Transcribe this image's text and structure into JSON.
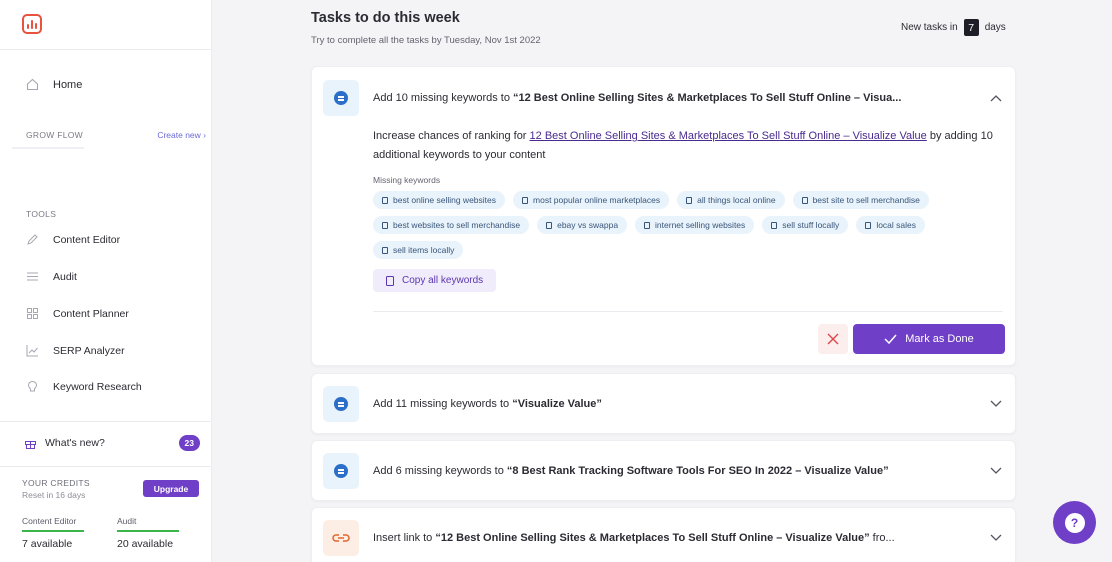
{
  "sidebar": {
    "home_label": "Home",
    "grow_flow_label": "GROW FLOW",
    "create_new_label": "Create new ›",
    "tools_label": "TOOLS",
    "tools": [
      {
        "label": "Content Editor",
        "icon": "pencil-icon"
      },
      {
        "label": "Audit",
        "icon": "lines-icon"
      },
      {
        "label": "Content Planner",
        "icon": "grid-icon"
      },
      {
        "label": "SERP Analyzer",
        "icon": "chart-line-icon"
      },
      {
        "label": "Keyword Research",
        "icon": "lightbulb-icon"
      }
    ],
    "whats_new_label": "What's new?",
    "whats_new_count": "23",
    "credits_title": "YOUR CREDITS",
    "credits_reset": "Reset in 16 days",
    "upgrade_label": "Upgrade",
    "credit_items": [
      {
        "label": "Content Editor",
        "value": "7 available"
      },
      {
        "label": "Audit",
        "value": "20 available"
      }
    ]
  },
  "header": {
    "title": "Tasks to do this week",
    "subtitle": "Try to complete all the tasks by Tuesday, Nov 1st 2022",
    "new_tasks_label": "New tasks in",
    "new_tasks_days": "7",
    "days_label": "days"
  },
  "tasks": [
    {
      "title_prefix": "Add 10 missing keywords to ",
      "title_bold": "“12 Best Online Selling Sites & Marketplaces To Sell Stuff Online – Visua...",
      "desc_prefix": "Increase chances of ranking for ",
      "desc_link": "12 Best Online Selling Sites & Marketplaces To Sell Stuff Online – Visualize Value",
      "desc_suffix": " by adding 10 additional keywords to your content",
      "missing_label": "Missing keywords",
      "keywords": [
        "best online selling websites",
        "most popular online marketplaces",
        "all things local online",
        "best site to sell merchandise",
        "best websites to sell merchandise",
        "ebay vs swappa",
        "internet selling websites",
        "sell stuff locally",
        "local sales",
        "sell items locally"
      ],
      "copy_label": "Copy all keywords",
      "done_label": "Mark as Done"
    },
    {
      "title_prefix": "Add 11 missing keywords to ",
      "title_bold": "“Visualize Value”"
    },
    {
      "title_prefix": "Add 6 missing keywords to ",
      "title_bold": "“8 Best Rank Tracking Software Tools For SEO In 2022 – Visualize Value”"
    },
    {
      "title_prefix": "Insert link to ",
      "title_bold": "“12 Best Online Selling Sites & Marketplaces To Sell Stuff Online – Visualize Value”",
      "title_suffix": " fro..."
    }
  ],
  "help_label": "?",
  "colors": {
    "accent": "#6f3fc7",
    "logo": "#e8533f",
    "chip_bg": "#e9f3fb",
    "danger": "#e0454a",
    "credit_bar": "#3bb54a"
  }
}
